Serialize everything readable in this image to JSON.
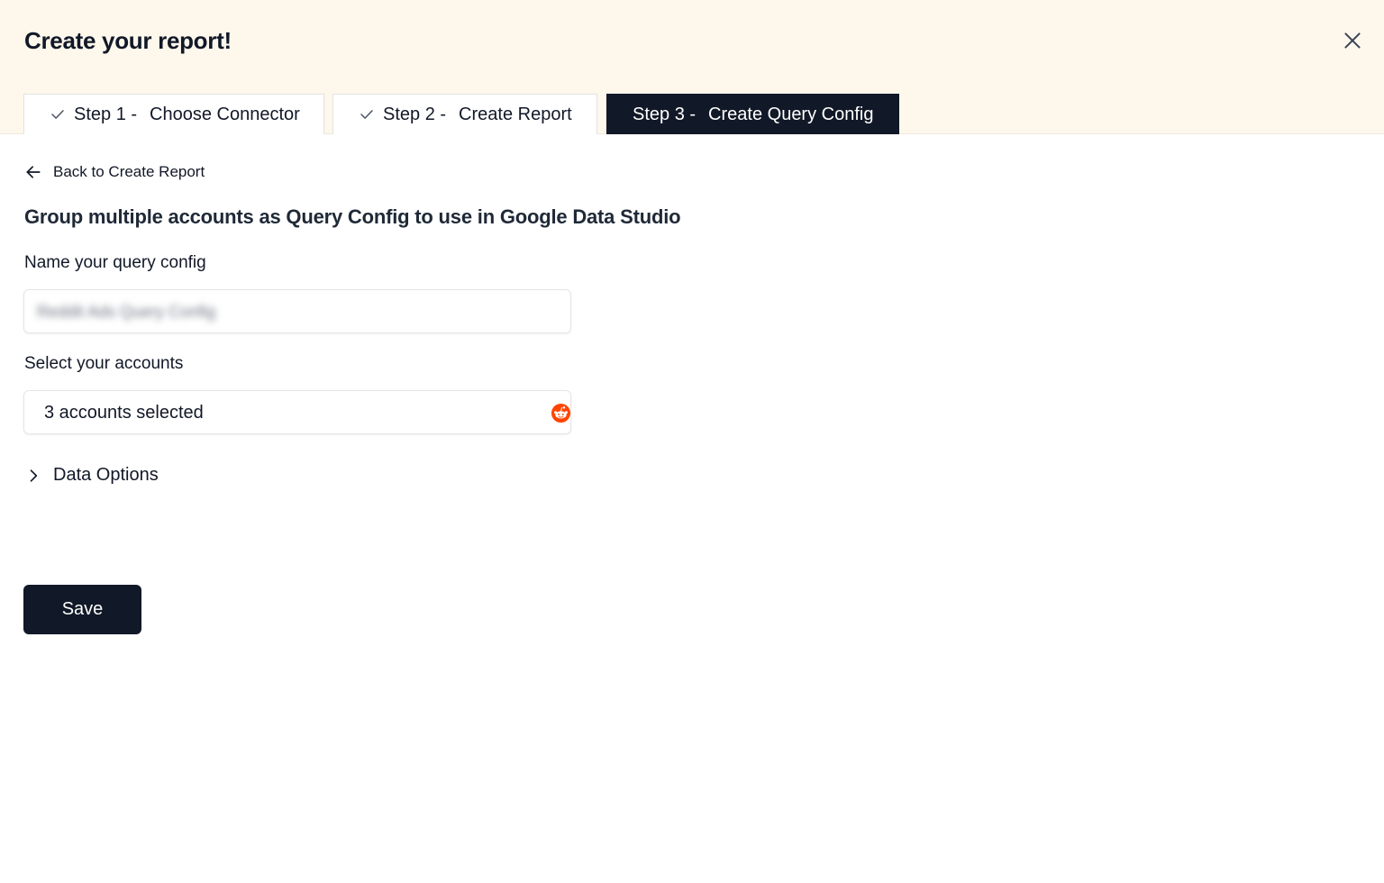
{
  "header": {
    "title": "Create your report!",
    "close_icon": "close-icon"
  },
  "steps": [
    {
      "number": "Step 1 -",
      "label": "Choose Connector",
      "status": "completed",
      "icon": "check-icon"
    },
    {
      "number": "Step 2 -",
      "label": "Create Report",
      "status": "completed",
      "icon": "check-icon"
    },
    {
      "number": "Step 3 -",
      "label": "Create Query Config",
      "status": "active"
    }
  ],
  "back_link": {
    "label": "Back to Create Report",
    "icon": "arrow-left-icon"
  },
  "subtitle": "Group multiple accounts as Query Config to use in Google Data Studio",
  "form": {
    "name_label": "Name your query config",
    "name_value": "Reddit Ads Query Config",
    "accounts_label": "Select your accounts",
    "accounts_value": "3 accounts selected",
    "accounts_icon": "reddit-icon",
    "data_options_label": "Data Options",
    "data_options_icon": "chevron-right-icon",
    "save_label": "Save"
  },
  "colors": {
    "header_bg": "#fdf7ec",
    "active_tab_bg": "#111827",
    "primary_button": "#111827",
    "reddit_orange": "#ff4500"
  }
}
